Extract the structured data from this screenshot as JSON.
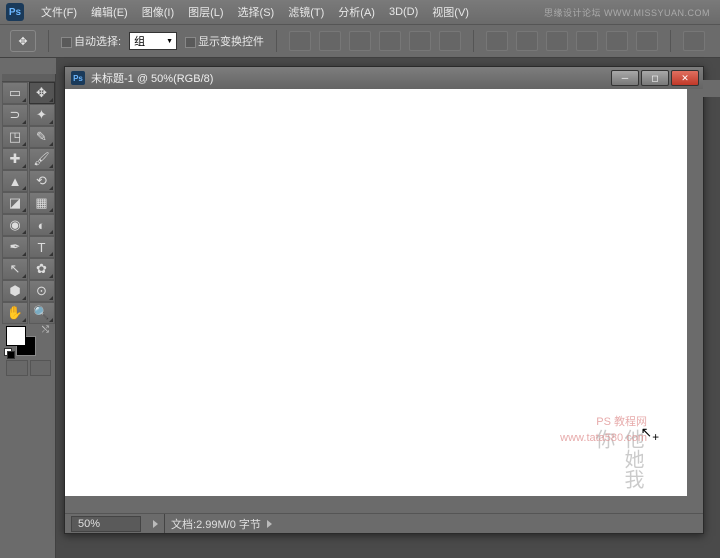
{
  "menu": {
    "items": [
      "文件(F)",
      "编辑(E)",
      "图像(I)",
      "图层(L)",
      "选择(S)",
      "滤镜(T)",
      "分析(A)",
      "3D(D)",
      "视图(V)"
    ],
    "watermark": "思缘设计论坛 WWW.MISSYUAN.COM"
  },
  "options": {
    "auto_select": "自动选择:",
    "group": "组",
    "show_transform": "显示变换控件"
  },
  "tools": [
    {
      "n": "marquee-tool",
      "g": "▭"
    },
    {
      "n": "move-tool",
      "g": "✥",
      "a": true
    },
    {
      "n": "lasso-tool",
      "g": "⊃"
    },
    {
      "n": "wand-tool",
      "g": "✦"
    },
    {
      "n": "crop-tool",
      "g": "◳"
    },
    {
      "n": "eyedropper-tool",
      "g": "✎"
    },
    {
      "n": "healing-tool",
      "g": "✚"
    },
    {
      "n": "brush-tool",
      "g": "🖌"
    },
    {
      "n": "stamp-tool",
      "g": "▲"
    },
    {
      "n": "history-brush-tool",
      "g": "⟲"
    },
    {
      "n": "eraser-tool",
      "g": "◪"
    },
    {
      "n": "gradient-tool",
      "g": "▦"
    },
    {
      "n": "blur-tool",
      "g": "◉"
    },
    {
      "n": "dodge-tool",
      "g": "◐"
    },
    {
      "n": "pen-tool",
      "g": "✒"
    },
    {
      "n": "type-tool",
      "g": "T"
    },
    {
      "n": "path-tool",
      "g": "↖"
    },
    {
      "n": "shape-tool",
      "g": "✿"
    },
    {
      "n": "3d-tool",
      "g": "⬢"
    },
    {
      "n": "camera-tool",
      "g": "⊙"
    },
    {
      "n": "hand-tool",
      "g": "✋"
    },
    {
      "n": "zoom-tool",
      "g": "🔍"
    }
  ],
  "document": {
    "title": "未标题-1 @ 50%(RGB/8)",
    "zoom": "50%",
    "info_label": "文档:",
    "info": "2.99M/0 字节"
  },
  "watermark2_l1": "PS 教程网",
  "watermark2_l2": "www.tata580.com"
}
